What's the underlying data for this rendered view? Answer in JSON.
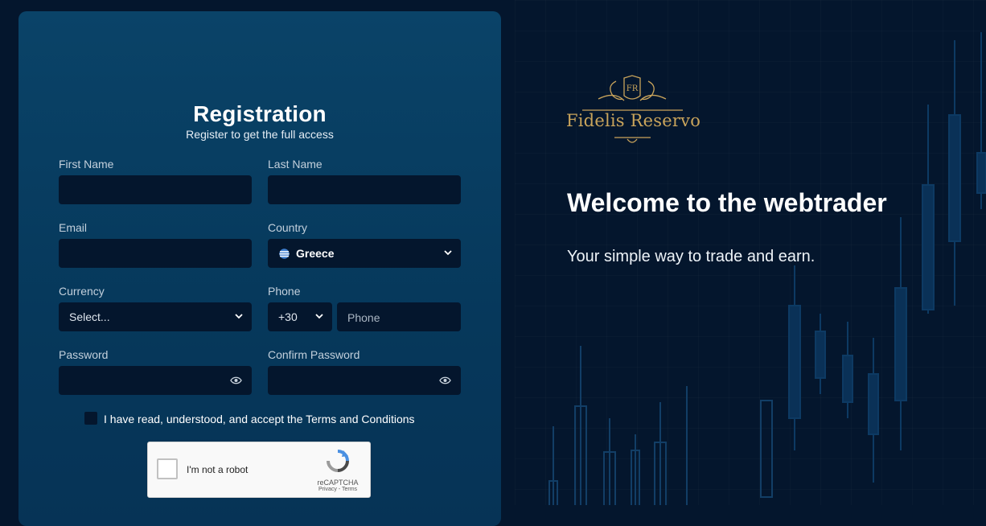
{
  "registration": {
    "title": "Registration",
    "subtitle": "Register to get the full access",
    "first_name_label": "First Name",
    "last_name_label": "Last Name",
    "email_label": "Email",
    "country_label": "Country",
    "country_value": "Greece",
    "currency_label": "Currency",
    "currency_value": "Select...",
    "phone_label": "Phone",
    "phone_code": "+30",
    "phone_placeholder": "Phone",
    "password_label": "Password",
    "confirm_password_label": "Confirm Password",
    "terms_text": "I have read, understood, and accept the Terms and Conditions"
  },
  "captcha": {
    "label": "I'm not a robot",
    "brand": "reCAPTCHA",
    "links": "Privacy - Terms"
  },
  "brand": {
    "name": "Fidelis Reservo",
    "monogram": "FR",
    "gold_color": "#c9a45b"
  },
  "hero": {
    "title": "Welcome to the webtrader",
    "tagline": "Your simple way to trade and earn."
  },
  "colors": {
    "page_bg": "#04162d",
    "panel_bg": "#0a4368",
    "input_bg": "#04162d"
  }
}
